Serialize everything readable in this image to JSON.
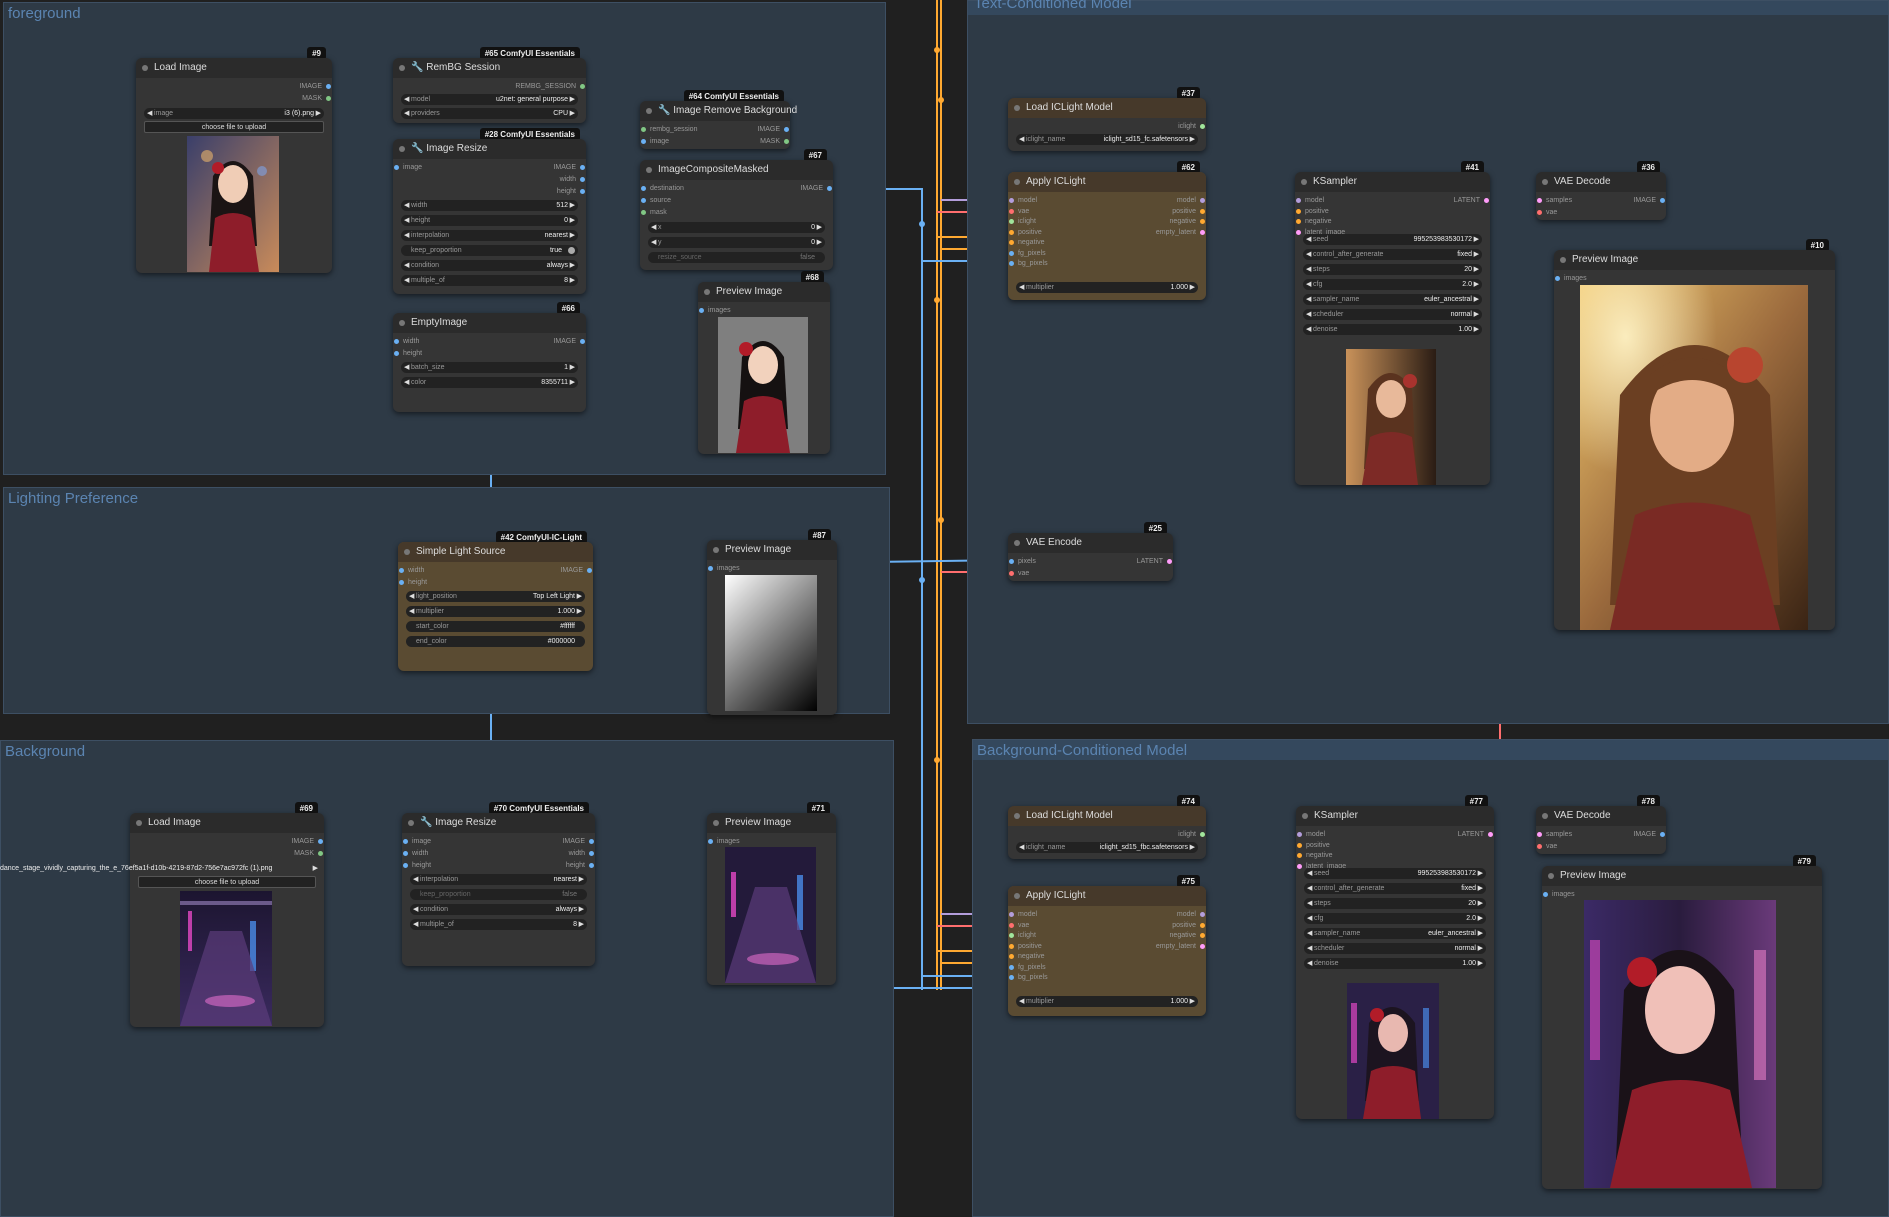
{
  "groups": {
    "foreground": "foreground",
    "lighting": "Lighting Preference",
    "text": "Text-Conditioned Model",
    "background": "Background",
    "bgcond": "Background-Conditioned Model"
  },
  "colors": {
    "link_image": "#6ab0f3",
    "link_model": "#b39ddb",
    "link_vae": "#ff6e6e",
    "link_cond": "#ffa931",
    "link_latent": "#ff9cf9",
    "link_iclight": "#a1e59b"
  },
  "nodes": {
    "load_fg": {
      "title": "Load Image",
      "badge": "#9",
      "out1": "IMAGE",
      "out2": "MASK",
      "w_label": "image",
      "w_value": "i3 (6).png",
      "upload": "choose file to upload"
    },
    "rembg": {
      "title": "RemBG Session",
      "badge": "#65 ComfyUI Essentials",
      "out1": "REMBG_SESSION",
      "w1_label": "model",
      "w1_value": "u2net: general purpose",
      "w2_label": "providers",
      "w2_value": "CPU"
    },
    "removebg": {
      "title": "Image Remove Background",
      "badge": "#64 ComfyUI Essentials",
      "in1": "rembg_session",
      "in2": "image",
      "out1": "IMAGE",
      "out2": "MASK"
    },
    "resize_fg": {
      "title": "Image Resize",
      "badge": "#28 ComfyUI Essentials",
      "in1": "image",
      "out1": "IMAGE",
      "out2": "width",
      "out3": "height",
      "w1_label": "width",
      "w1_value": "512",
      "w2_label": "height",
      "w2_value": "0",
      "w3_label": "interpolation",
      "w3_value": "nearest",
      "w4_label": "keep_proportion",
      "w4_value": "true",
      "w5_label": "condition",
      "w5_value": "always",
      "w6_label": "multiple_of",
      "w6_value": "8"
    },
    "composite": {
      "title": "ImageCompositeMasked",
      "badge": "#67",
      "in1": "destination",
      "in2": "source",
      "in3": "mask",
      "out1": "IMAGE",
      "w1_label": "x",
      "w1_value": "0",
      "w2_label": "y",
      "w2_value": "0",
      "w3_label": "resize_source",
      "w3_value": "false"
    },
    "preview_fg": {
      "title": "Preview Image",
      "badge": "#68",
      "in1": "images"
    },
    "empty": {
      "title": "EmptyImage",
      "badge": "#66",
      "in1": "width",
      "in2": "height",
      "out1": "IMAGE",
      "w1_label": "batch_size",
      "w1_value": "1",
      "w2_label": "color",
      "w2_value": "8355711"
    },
    "light": {
      "title": "Simple Light Source",
      "badge": "#42 ComfyUI-IC-Light",
      "in1": "width",
      "in2": "height",
      "out1": "IMAGE",
      "w1_label": "light_position",
      "w1_value": "Top Left Light",
      "w2_label": "multiplier",
      "w2_value": "1.000",
      "w3_label": "start_color",
      "w3_value": "#ffffff",
      "w4_label": "end_color",
      "w4_value": "#000000"
    },
    "preview_light": {
      "title": "Preview Image",
      "badge": "#87",
      "in1": "images"
    },
    "load_bg": {
      "title": "Load Image",
      "badge": "#69",
      "out1": "IMAGE",
      "out2": "MASK",
      "w_label": "image",
      "w_value": "dance_stage_vividly_capturing_the_e_76ef5a1f-d10b-4219-87d2-756e7ac972fc (1).png",
      "upload": "choose file to upload"
    },
    "resize_bg": {
      "title": "Image Resize",
      "badge": "#70 ComfyUI Essentials",
      "in1": "image",
      "in2": "width",
      "in3": "height",
      "out1": "IMAGE",
      "out2": "width",
      "out3": "height",
      "w1_label": "interpolation",
      "w1_value": "nearest",
      "w2_label": "keep_proportion",
      "w2_value": "false",
      "w3_label": "condition",
      "w3_value": "always",
      "w4_label": "multiple_of",
      "w4_value": "8"
    },
    "preview_bg": {
      "title": "Preview Image",
      "badge": "#71",
      "in1": "images"
    },
    "loadic1": {
      "title": "Load ICLight Model",
      "badge": "#37",
      "out1": "iclight",
      "w1_label": "iclight_name",
      "w1_value": "iclight_sd15_fc.safetensors"
    },
    "applyic1": {
      "title": "Apply ICLight",
      "badge": "#62",
      "inputs": [
        "model",
        "vae",
        "iclight",
        "positive",
        "negative",
        "fg_pixels",
        "bg_pixels"
      ],
      "outputs": [
        "model",
        "positive",
        "negative",
        "empty_latent"
      ],
      "w1_label": "multiplier",
      "w1_value": "1.000"
    },
    "vaeenc": {
      "title": "VAE Encode",
      "badge": "#25",
      "in1": "pixels",
      "in2": "vae",
      "out1": "LATENT"
    },
    "ksampler1": {
      "title": "KSampler",
      "badge": "#41",
      "inputs": [
        "model",
        "positive",
        "negative",
        "latent_image"
      ],
      "out1": "LATENT",
      "widgets": [
        {
          "label": "seed",
          "value": "995253983530172"
        },
        {
          "label": "control_after_generate",
          "value": "fixed"
        },
        {
          "label": "steps",
          "value": "20"
        },
        {
          "label": "cfg",
          "value": "2.0"
        },
        {
          "label": "sampler_name",
          "value": "euler_ancestral"
        },
        {
          "label": "scheduler",
          "value": "normal"
        },
        {
          "label": "denoise",
          "value": "1.00"
        }
      ]
    },
    "vaedec1": {
      "title": "VAE Decode",
      "badge": "#36",
      "in1": "samples",
      "in2": "vae",
      "out1": "IMAGE"
    },
    "preview_out1": {
      "title": "Preview Image",
      "badge": "#10",
      "in1": "images"
    },
    "loadic2": {
      "title": "Load ICLight Model",
      "badge": "#74",
      "out1": "iclight",
      "w1_label": "iclight_name",
      "w1_value": "iclight_sd15_fbc.safetensors"
    },
    "applyic2": {
      "title": "Apply ICLight",
      "badge": "#75",
      "inputs": [
        "model",
        "vae",
        "iclight",
        "positive",
        "negative",
        "fg_pixels",
        "bg_pixels"
      ],
      "outputs": [
        "model",
        "positive",
        "negative",
        "empty_latent"
      ],
      "w1_label": "multiplier",
      "w1_value": "1.000"
    },
    "ksampler2": {
      "title": "KSampler",
      "badge": "#77",
      "inputs": [
        "model",
        "positive",
        "negative",
        "latent_image"
      ],
      "out1": "LATENT",
      "widgets": [
        {
          "label": "seed",
          "value": "995253983530172"
        },
        {
          "label": "control_after_generate",
          "value": "fixed"
        },
        {
          "label": "steps",
          "value": "20"
        },
        {
          "label": "cfg",
          "value": "2.0"
        },
        {
          "label": "sampler_name",
          "value": "euler_ancestral"
        },
        {
          "label": "scheduler",
          "value": "normal"
        },
        {
          "label": "denoise",
          "value": "1.00"
        }
      ]
    },
    "vaedec2": {
      "title": "VAE Decode",
      "badge": "#78",
      "in1": "samples",
      "in2": "vae",
      "out1": "IMAGE"
    },
    "preview_out2": {
      "title": "Preview Image",
      "badge": "#79",
      "in1": "images"
    }
  }
}
